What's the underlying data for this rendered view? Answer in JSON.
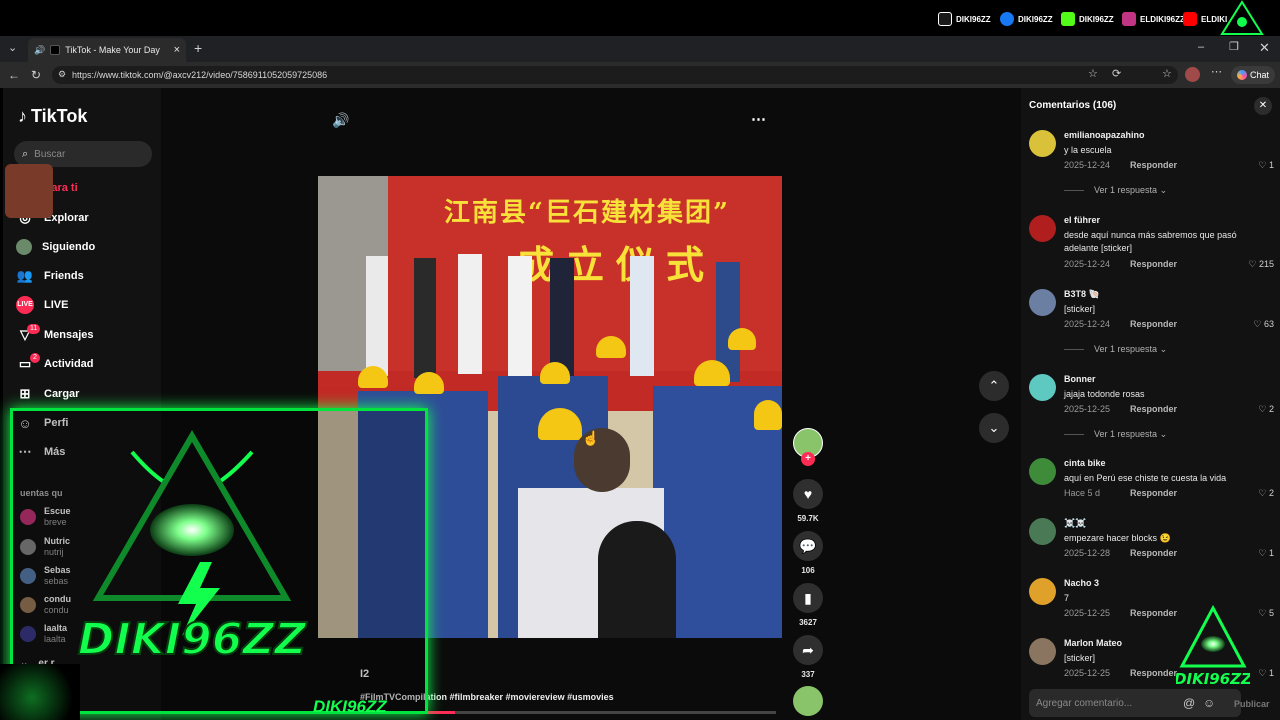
{
  "social": [
    {
      "icon": "tiktok-icon",
      "handle": "DIKI96ZZ",
      "color": "#ffffff"
    },
    {
      "icon": "facebook-icon",
      "handle": "DIKI96ZZ",
      "color": "#1877f2"
    },
    {
      "icon": "kick-icon",
      "handle": "DIKI96ZZ",
      "color": "#53fc18"
    },
    {
      "icon": "instagram-icon",
      "handle": "ELDIKI96ZZ",
      "color": "#c13584"
    },
    {
      "icon": "youtube-icon",
      "handle": "ELDIKI",
      "color": "#ff0000"
    }
  ],
  "browser": {
    "tab_title": "TikTok - Make Your Day",
    "url": "https://www.tiktok.com/@axcv212/video/7586911052059725086",
    "chat_label": "Chat"
  },
  "sidebar": {
    "logo": "TikTok",
    "search_placeholder": "Buscar",
    "items": [
      {
        "label": "Para ti",
        "icon": "home-icon",
        "active": true
      },
      {
        "label": "Explorar",
        "icon": "compass-icon"
      },
      {
        "label": "Siguiendo",
        "icon": "following-icon"
      },
      {
        "label": "Friends",
        "icon": "friends-icon"
      },
      {
        "label": "LIVE",
        "icon": "live-icon"
      },
      {
        "label": "Mensajes",
        "icon": "messages-icon",
        "badge": "11"
      },
      {
        "label": "Actividad",
        "icon": "activity-icon",
        "badge": "2"
      },
      {
        "label": "Cargar",
        "icon": "upload-icon"
      },
      {
        "label": "Perfi",
        "icon": "profile-icon"
      },
      {
        "label": "Más",
        "icon": "more-icon"
      }
    ],
    "following_heading": "uentas qu",
    "following": [
      {
        "line1": "Escue",
        "line2": "breve"
      },
      {
        "line1": "Nutric",
        "line2": "nutrij"
      },
      {
        "line1": "Sebas",
        "line2": "sebas"
      },
      {
        "line1": "condu",
        "line2": "condu"
      },
      {
        "line1": "laalta",
        "line2": "laalta"
      }
    ],
    "see_more": "er r"
  },
  "video": {
    "banner_line1": "江南县“巨石建材集团”",
    "banner_line2": "成立仪式",
    "author_fragment": "I2",
    "caption": "#FilmTVCompilation #filmbreaker #moviereview #usmovies",
    "progress": 0.3
  },
  "actions": {
    "likes": "59.7K",
    "comments": "106",
    "saves": "3627",
    "shares": "337"
  },
  "comments_panel": {
    "title": "Comentarios (106)",
    "reply_label": "Responder",
    "view_reply_label": "Ver 1 respuesta",
    "input_placeholder": "Agregar comentario...",
    "publish_label": "Publicar",
    "items": [
      {
        "user": "emilianoapazahino",
        "text": "y la escuela",
        "date": "2025-12-24",
        "likes": "1",
        "avatar": "#d9c23a"
      },
      {
        "user": "el führer",
        "text": "desde aquí nunca más sabremos que pasó adelante [sticker]",
        "date": "2025-12-24",
        "likes": "215",
        "avatar": "#b01e1e"
      },
      {
        "user": "B3T8 🐚",
        "text": "[sticker]",
        "date": "2025-12-24",
        "likes": "63",
        "avatar": "#6b7fa3"
      },
      {
        "user": "Bonner",
        "text": "jajaja todonde rosas",
        "date": "2025-12-25",
        "likes": "2",
        "avatar": "#5ec9c0"
      },
      {
        "user": "cinta bike",
        "text": "aquí en Perú ese chiste te cuesta la vida",
        "date": "Hace 5 d",
        "likes": "2",
        "avatar": "#3e8c3a"
      },
      {
        "user": "☠️☠️",
        "text": "empezare hacer blocks 😉",
        "date": "2025-12-28",
        "likes": "1",
        "avatar": "#4a7a55"
      },
      {
        "user": "Nacho 3",
        "text": "7",
        "date": "2025-12-25",
        "likes": "5",
        "avatar": "#e0a12a"
      },
      {
        "user": "Marlon Mateo",
        "text": "[sticker]",
        "date": "2025-12-25",
        "likes": "1",
        "avatar": "#8a7560"
      }
    ]
  },
  "overlay": {
    "brand": "DIKI96ZZ",
    "brand_footer": "DIKI96ZZ",
    "corner_brand": "DIKI96ZZ",
    "accent": "#13ff4e"
  }
}
